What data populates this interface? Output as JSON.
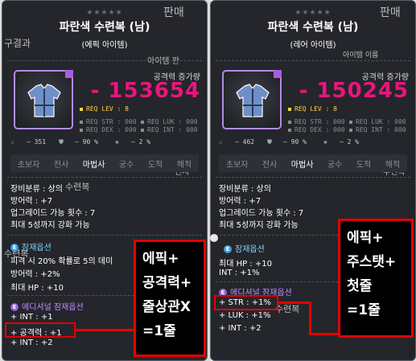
{
  "background": {
    "left_snippets": [
      "판매",
      "구결과",
      "아이템 판",
      "전사",
      "수련복",
      "수련복"
    ],
    "right_snippets": [
      "판매",
      "아이템 이름",
      "수련복",
      "수련복"
    ]
  },
  "left_tooltip": {
    "stars": "★★★★★",
    "title": "파란색 수련복 (남)",
    "grade": "(에픽 아이템)",
    "attack_label": "공격력 증가량",
    "attack_value": "- 153654",
    "req_lev": "REQ LEV :   8",
    "req_str": "REQ STR : 000",
    "req_dex": "REQ DEX : 000",
    "req_luk": "REQ LUK : 000",
    "req_int": "REQ INT : 000",
    "stat_a": "– 351",
    "stat_b": "– 90 %",
    "stat_c": "– 2 %",
    "jobs": [
      "초보자",
      "전사",
      "마법사",
      "궁수",
      "도적",
      "해적"
    ],
    "active_job": "마법사",
    "lines": [
      "장비분류 : 상의",
      "방어력 : +7",
      "업그레이드 가능 횟수 : 7",
      "최대 5성까지 강화 가능"
    ],
    "potential_header": "잠재옵션",
    "potential_lines": [
      "피격 시 20% 확률로 5의 데미",
      "방어력 : +2%",
      "최대 HP : +10"
    ],
    "additional_header": "에디셔널 잠재옵션",
    "additional_lines": [
      "+ INT : +1",
      "+ 공격력 : +1",
      "+ INT : +2"
    ]
  },
  "right_tooltip": {
    "stars": "★★★★★",
    "title": "파란색 수련복 (남)",
    "grade": "(레어 아이템)",
    "attack_label": "공격력 증가량",
    "attack_value": "- 150245",
    "req_lev": "REQ LEV :   8",
    "req_str": "REQ STR : 000",
    "req_dex": "REQ DEX : 000",
    "req_luk": "REQ LUK : 000",
    "req_int": "REQ INT : 000",
    "stat_a": "– 462",
    "stat_b": "– 90 %",
    "stat_c": "– 2 %",
    "jobs": [
      "초보자",
      "전사",
      "마법사",
      "궁수",
      "도적",
      "해적"
    ],
    "active_job": "마법사",
    "lines": [
      "장비분류 : 상의",
      "방어력 : +7",
      "업그레이드 가능 횟수 : 7",
      "최대 5성까지 강화 가능"
    ],
    "potential_header": "잠재옵션",
    "potential_lines": [
      "최대 HP : +10",
      "INT : +1%"
    ],
    "additional_header": "에디셔널 잠재옵션",
    "additional_lines": [
      "+ STR : +1%",
      "+ LUK : +1%",
      "+ INT : +2"
    ]
  },
  "annotations": {
    "left_note": [
      "에픽+",
      "공격력+",
      "줄상관X",
      "=1줄"
    ],
    "right_note": [
      "에픽+",
      "주스탯+",
      "첫줄",
      "=1줄"
    ]
  },
  "colors": {
    "attack": "#e8167d",
    "annotation_red": "#e60000",
    "epic_purple": "#a45ee0"
  }
}
